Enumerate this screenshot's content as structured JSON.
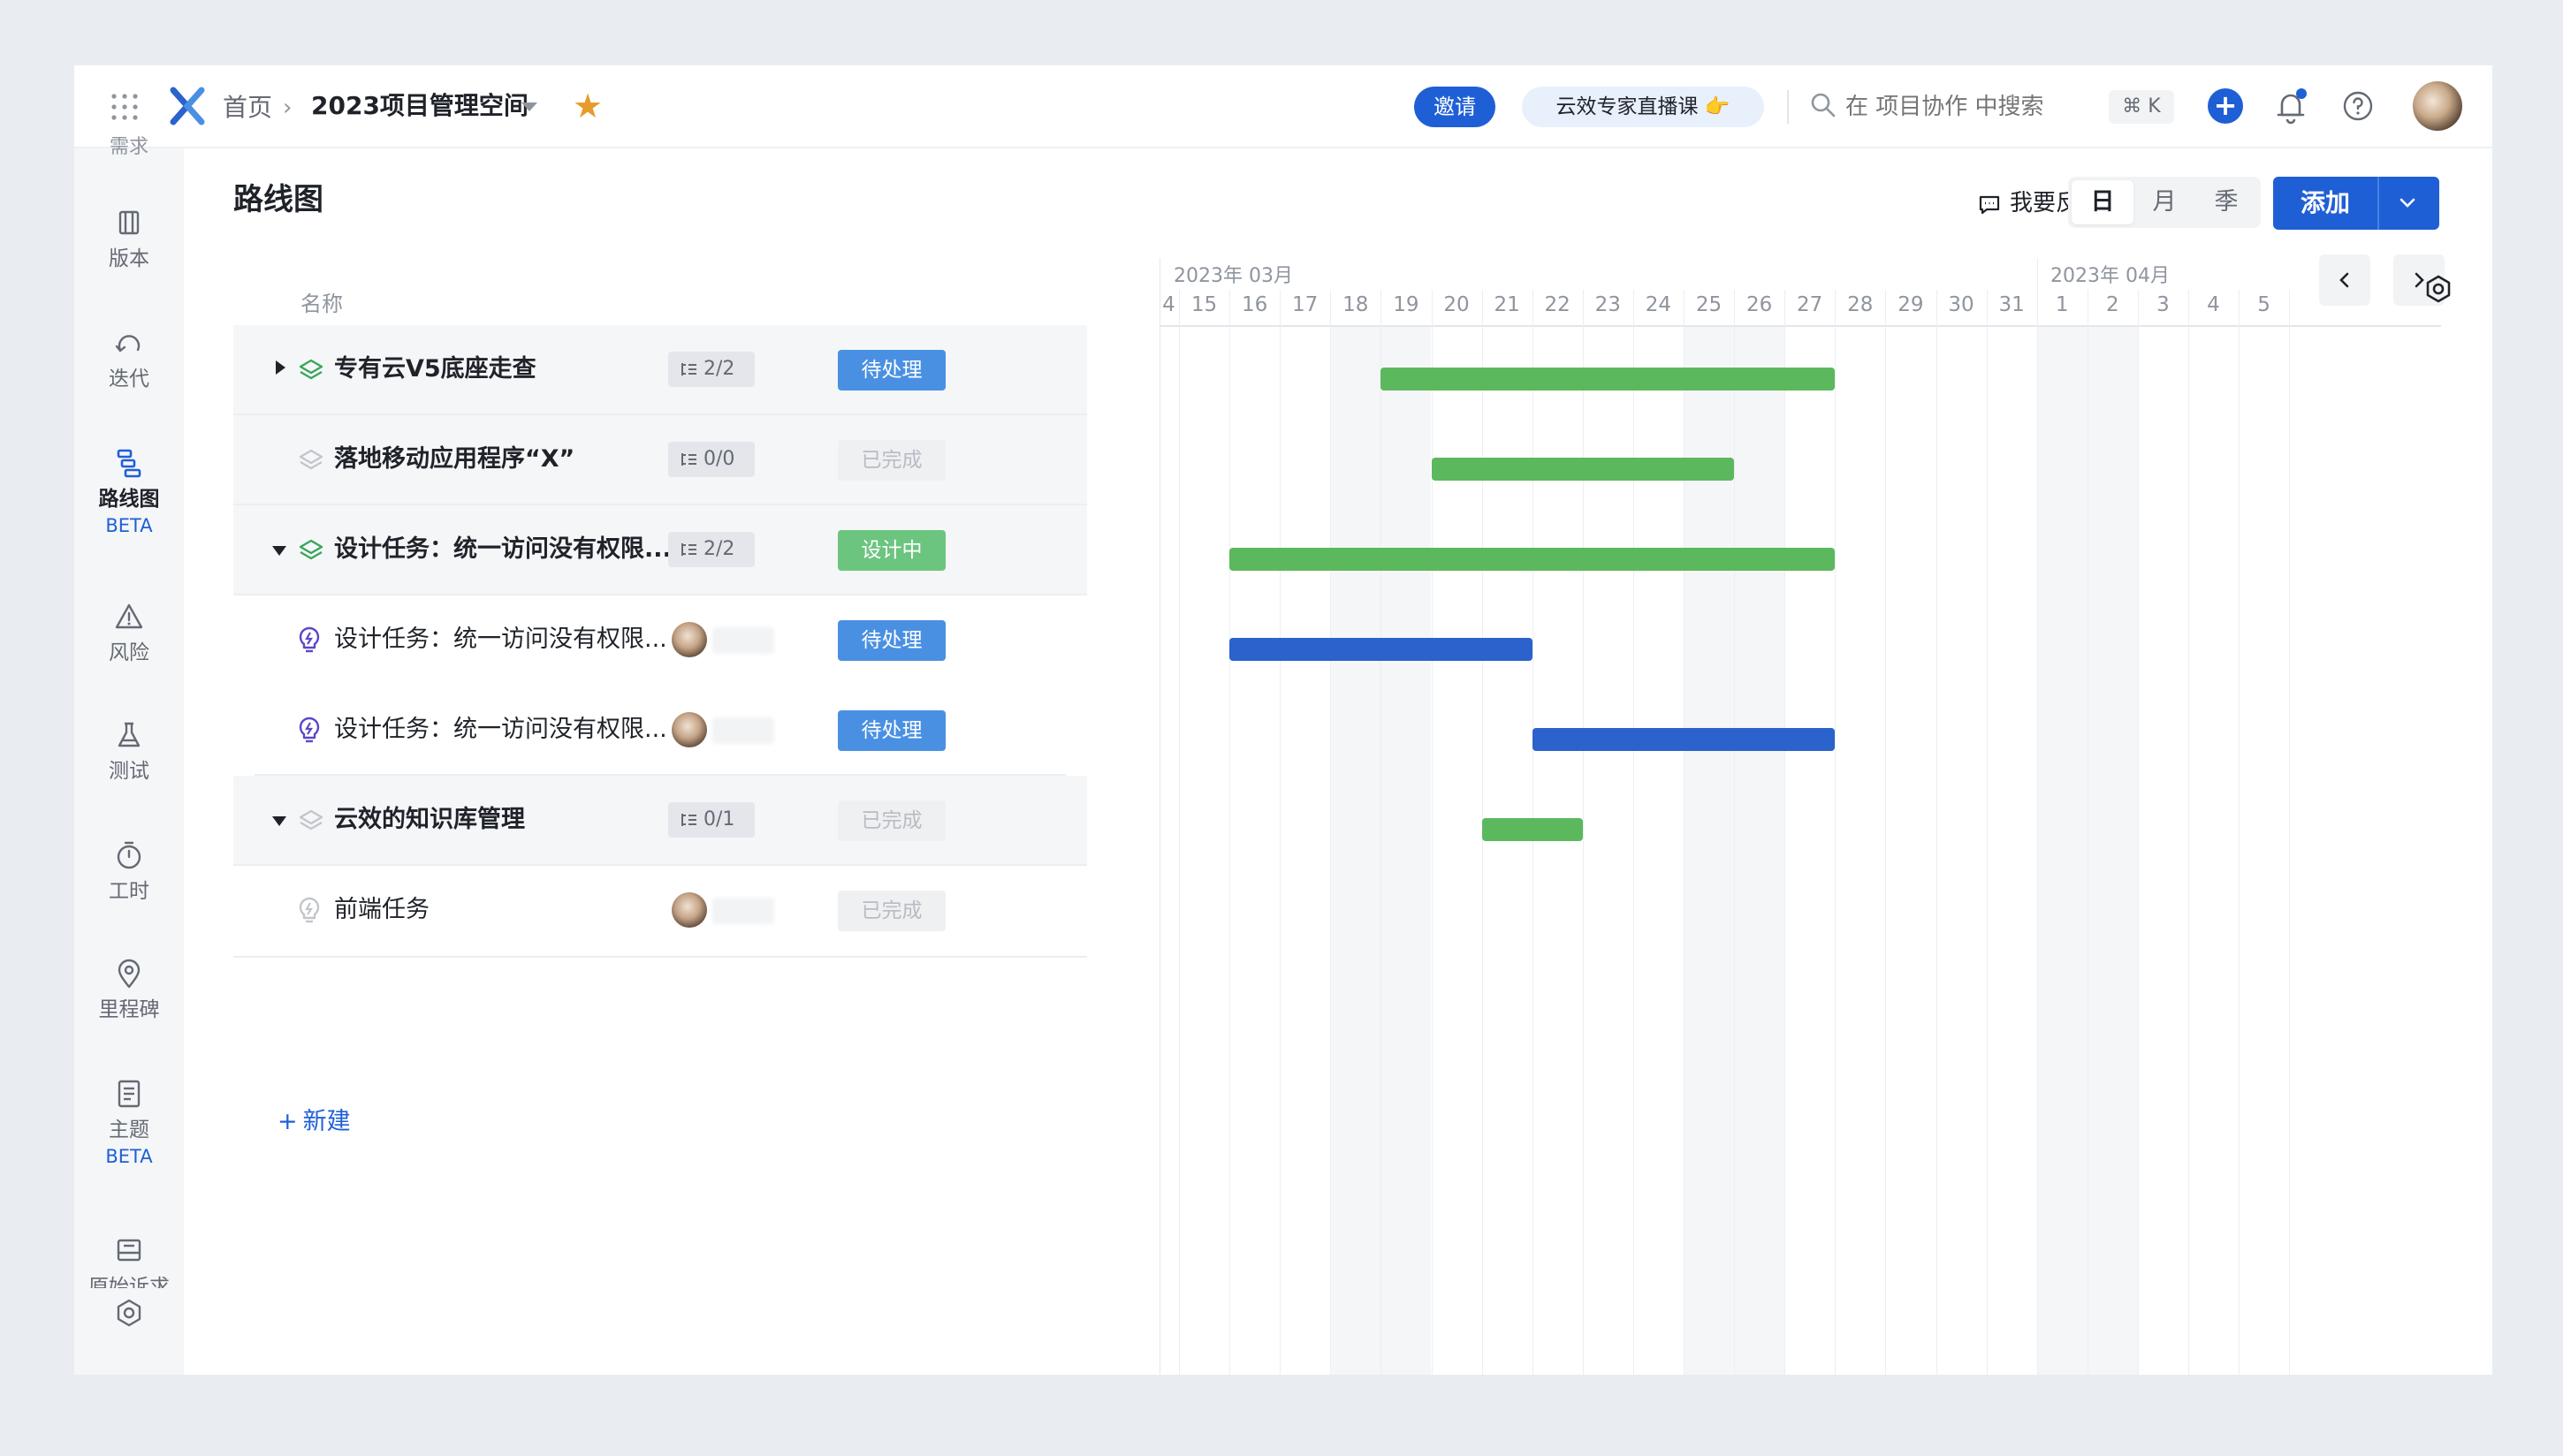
{
  "topbar": {
    "home": "首页",
    "project": "2023项目管理空间",
    "invite": "邀请",
    "live_course": "云效专家直播课 👉",
    "search_placeholder": "在 项目协作 中搜索",
    "shortcut": "⌘ K"
  },
  "sidenav": {
    "top_partial": "需求",
    "items": [
      {
        "label": "版本",
        "icon": "version-icon"
      },
      {
        "label": "迭代",
        "icon": "iteration-icon"
      },
      {
        "label": "路线图",
        "icon": "roadmap-icon",
        "badge": "BETA",
        "active": true
      },
      {
        "label": "风险",
        "icon": "risk-icon"
      },
      {
        "label": "测试",
        "icon": "test-icon"
      },
      {
        "label": "工时",
        "icon": "timer-icon"
      },
      {
        "label": "里程碑",
        "icon": "milestone-icon"
      },
      {
        "label": "主题",
        "icon": "theme-icon",
        "badge": "BETA"
      }
    ],
    "bottom_partial": "原始诉求"
  },
  "page": {
    "title": "路线图",
    "feedback": "我要反馈",
    "scales": [
      "日",
      "月",
      "季"
    ],
    "active_scale": "日",
    "add": "添加",
    "col_name": "名称",
    "new": "新建"
  },
  "rows": [
    {
      "name": "专有云V5底座走查",
      "count": "2/2",
      "status": "待处理",
      "kind": "parent"
    },
    {
      "name": "落地移动应用程序“X”",
      "count": "0/0",
      "status": "已完成",
      "kind": "parent"
    },
    {
      "name": "设计任务：统一访问没有权限...",
      "count": "2/2",
      "status": "设计中",
      "kind": "parent"
    },
    {
      "name": "设计任务：统一访问没有权限...",
      "status": "待处理",
      "kind": "child"
    },
    {
      "name": "设计任务：统一访问没有权限...",
      "status": "待处理",
      "kind": "child"
    },
    {
      "name": "云效的知识库管理",
      "count": "0/1",
      "status": "已完成",
      "kind": "parent"
    },
    {
      "name": "前端任务",
      "status": "已完成",
      "kind": "child"
    }
  ],
  "gantt": {
    "month_march": "2023年 03月",
    "month_april": "2023年 04月",
    "days": [
      "4",
      "15",
      "16",
      "17",
      "18",
      "19",
      "20",
      "21",
      "22",
      "23",
      "24",
      "25",
      "26",
      "27",
      "28",
      "29",
      "30",
      "31",
      "1",
      "2",
      "3",
      "4",
      "5"
    ],
    "bars": [
      {
        "row": 0,
        "start": "2023-03-19",
        "end": "2023-03-27",
        "color": "#5cb85c"
      },
      {
        "row": 1,
        "start": "2023-03-20",
        "end": "2023-03-25",
        "color": "#5cb85c"
      },
      {
        "row": 2,
        "start": "2023-03-16",
        "end": "2023-03-27",
        "color": "#5cb85c"
      },
      {
        "row": 3,
        "start": "2023-03-16",
        "end": "2023-03-21",
        "color": "#2b62cc"
      },
      {
        "row": 4,
        "start": "2023-03-22",
        "end": "2023-03-27",
        "color": "#2b62cc"
      },
      {
        "row": 5,
        "start": "2023-03-21",
        "end": "2023-03-22",
        "color": "#5cb85c"
      }
    ]
  },
  "colors": {
    "brand": "#1f5fd6",
    "pending": "#4a90e2",
    "design": "#6cc57f",
    "bar_green": "#5cb85c",
    "bar_blue": "#2b62cc"
  }
}
